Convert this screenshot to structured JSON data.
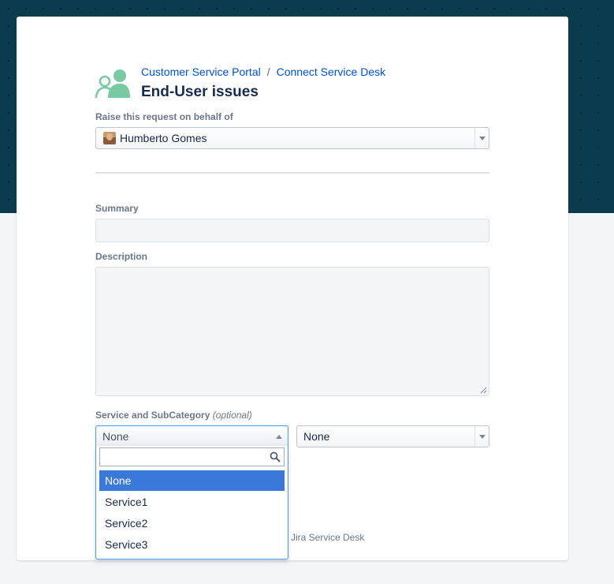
{
  "breadcrumb": {
    "portal": "Customer Service Portal",
    "separator": "/",
    "desk": "Connect Service Desk"
  },
  "page_title": "End-User issues",
  "raise_on_behalf": {
    "label": "Raise this request on behalf of",
    "selected_user": "Humberto Gomes"
  },
  "summary": {
    "label": "Summary",
    "value": ""
  },
  "description": {
    "label": "Description",
    "value": ""
  },
  "service": {
    "label": "Service and SubCategory",
    "optional_hint": "(optional)",
    "primary_value": "None",
    "secondary_value": "None",
    "search_value": "",
    "options": [
      "None",
      "Service1",
      "Service2",
      "Service3"
    ],
    "highlighted_option": "None"
  },
  "footer": {
    "powered_by_fragment": "Jira Service Desk"
  },
  "colors": {
    "hero_background": "#0b3c4e",
    "link": "#0052cc",
    "icon_green": "#79c9a2",
    "option_highlight": "#3a79d9"
  },
  "icons": {
    "header": "people-icon",
    "select_arrow": "chevron-down-icon",
    "search": "search-icon"
  }
}
